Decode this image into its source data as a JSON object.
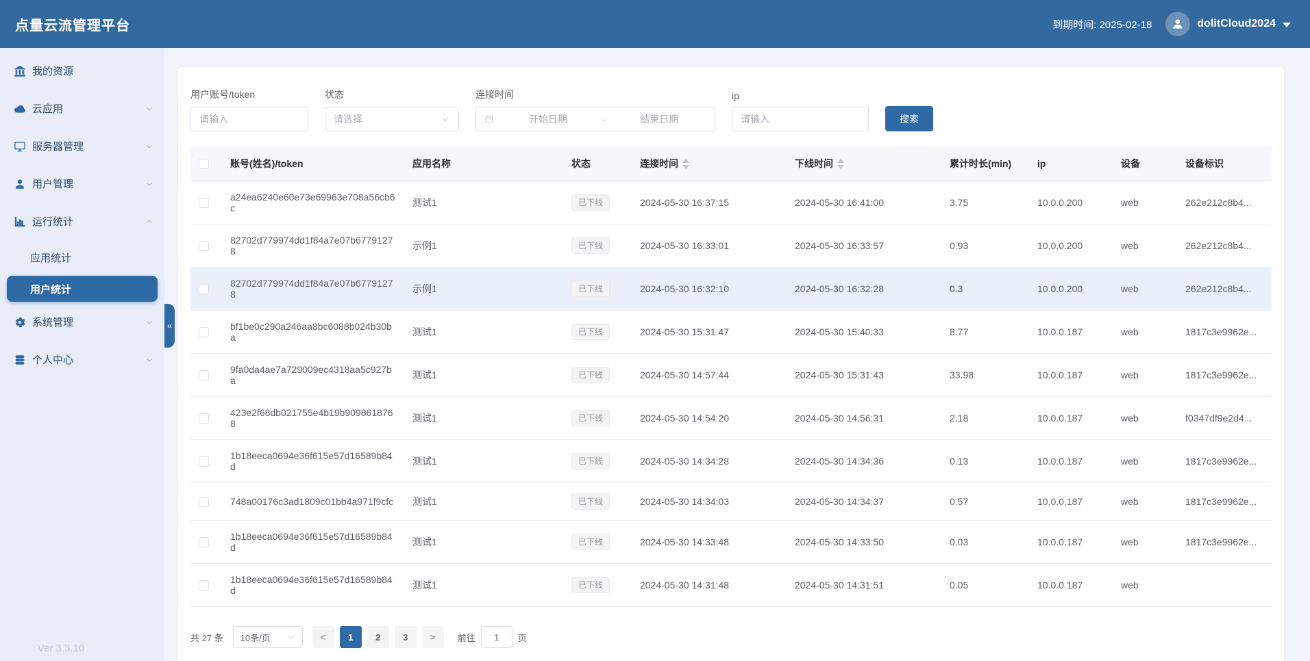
{
  "header": {
    "title": "点量云流管理平台",
    "expiry": "到期时间: 2025-02-18",
    "username": "dolitCloud2024",
    "avatar_icon": "user-avatar-icon"
  },
  "sidebar": {
    "items": [
      {
        "label": "我的资源",
        "icon": "bank-icon",
        "chevron": null
      },
      {
        "label": "云应用",
        "icon": "cloud-icon",
        "chevron": "down"
      },
      {
        "label": "服务器管理",
        "icon": "monitor-icon",
        "chevron": "down"
      },
      {
        "label": "用户管理",
        "icon": "user-icon",
        "chevron": "down"
      },
      {
        "label": "运行统计",
        "icon": "bar-chart-icon",
        "chevron": "up",
        "children": [
          "应用统计",
          "用户统计"
        ],
        "active_child": "用户统计"
      },
      {
        "label": "系统管理",
        "icon": "gear-icon",
        "chevron": "down"
      },
      {
        "label": "个人中心",
        "icon": "database-icon",
        "chevron": "down"
      }
    ],
    "collapse_glyph": "«",
    "version": "Ver 3.3.10"
  },
  "filters": {
    "account_label": "用户账号/token",
    "account_placeholder": "请输入",
    "status_label": "状态",
    "status_placeholder": "请选择",
    "time_label": "连接时间",
    "date_icon": "calendar-icon",
    "date_start_placeholder": "开始日期",
    "date_separator": "-",
    "date_end_placeholder": "结束日期",
    "ip_label": "ip",
    "ip_placeholder": "请输入",
    "search_label": "搜索"
  },
  "table": {
    "columns": {
      "token": "账号(姓名)/token",
      "app": "应用名称",
      "status": "状态",
      "connect": "连接时间",
      "offline": "下线时间",
      "duration": "累计时长(min)",
      "ip": "ip",
      "device": "设备",
      "device_id": "设备标识"
    },
    "rows": [
      {
        "token": "a24ea6240e60e73e69963e708a56cb6c",
        "app": "测试1",
        "status": "已下线",
        "connect": "2024-05-30 16:37:15",
        "offline": "2024-05-30 16:41:00",
        "duration": "3.75",
        "ip": "10.0.0.200",
        "device": "web",
        "device_id": "262e212c8b4...",
        "highlighted": false
      },
      {
        "token": "82702d779974dd1f84a7e07b67791278",
        "app": "示例1",
        "status": "已下线",
        "connect": "2024-05-30 16:33:01",
        "offline": "2024-05-30 16:33:57",
        "duration": "0.93",
        "ip": "10.0.0.200",
        "device": "web",
        "device_id": "262e212c8b4...",
        "highlighted": false
      },
      {
        "token": "82702d779974dd1f84a7e07b67791278",
        "app": "示例1",
        "status": "已下线",
        "connect": "2024-05-30 16:32:10",
        "offline": "2024-05-30 16:32:28",
        "duration": "0.3",
        "ip": "10.0.0.200",
        "device": "web",
        "device_id": "262e212c8b4...",
        "highlighted": true
      },
      {
        "token": "bf1be0c290a246aa8bc6088b024b30ba",
        "app": "测试1",
        "status": "已下线",
        "connect": "2024-05-30 15:31:47",
        "offline": "2024-05-30 15:40:33",
        "duration": "8.77",
        "ip": "10.0.0.187",
        "device": "web",
        "device_id": "1817c3e9962e...",
        "highlighted": false
      },
      {
        "token": "9fa0da4ae7a729009ec4318aa5c927ba",
        "app": "测试1",
        "status": "已下线",
        "connect": "2024-05-30 14:57:44",
        "offline": "2024-05-30 15:31:43",
        "duration": "33.98",
        "ip": "10.0.0.187",
        "device": "web",
        "device_id": "1817c3e9962e...",
        "highlighted": false
      },
      {
        "token": "423e2f68db021755e4b19b9098618768",
        "app": "测试1",
        "status": "已下线",
        "connect": "2024-05-30 14:54:20",
        "offline": "2024-05-30 14:56:31",
        "duration": "2.18",
        "ip": "10.0.0.187",
        "device": "web",
        "device_id": "f0347df9e2d4...",
        "highlighted": false
      },
      {
        "token": "1b18eeca0694e36f615e57d16589b84d",
        "app": "测试1",
        "status": "已下线",
        "connect": "2024-05-30 14:34:28",
        "offline": "2024-05-30 14:34:36",
        "duration": "0.13",
        "ip": "10.0.0.187",
        "device": "web",
        "device_id": "1817c3e9962e...",
        "highlighted": false
      },
      {
        "token": "748a00176c3ad1809c01bb4a971f9cfc",
        "app": "测试1",
        "status": "已下线",
        "connect": "2024-05-30 14:34:03",
        "offline": "2024-05-30 14:34:37",
        "duration": "0.57",
        "ip": "10.0.0.187",
        "device": "web",
        "device_id": "1817c3e9962e...",
        "highlighted": false
      },
      {
        "token": "1b18eeca0694e36f615e57d16589b84d",
        "app": "测试1",
        "status": "已下线",
        "connect": "2024-05-30 14:33:48",
        "offline": "2024-05-30 14:33:50",
        "duration": "0.03",
        "ip": "10.0.0.187",
        "device": "web",
        "device_id": "1817c3e9962e...",
        "highlighted": false
      },
      {
        "token": "1b18eeca0694e36f615e57d16589b84d",
        "app": "测试1",
        "status": "已下线",
        "connect": "2024-05-30 14:31:48",
        "offline": "2024-05-30 14:31:51",
        "duration": "0.05",
        "ip": "10.0.0.187",
        "device": "web",
        "device_id": "",
        "highlighted": false
      }
    ]
  },
  "pagination": {
    "total": "共 27 条",
    "page_size": "10条/页",
    "pages": [
      "1",
      "2",
      "3"
    ],
    "active_page": "1",
    "prev_icon": "chevron-left-icon",
    "next_icon": "chevron-right-icon",
    "goto_label": "前往",
    "goto_value": "1",
    "page_suffix": "页"
  },
  "colors": {
    "accent": "#2e6aa5",
    "header_bg": "#33699f",
    "sidebar_bg": "#e8edf8",
    "row_highlight": "#e9f0fa",
    "badge_bg": "#f4f4f5",
    "badge_text": "#909399",
    "badge_border": "#e9e9eb"
  }
}
